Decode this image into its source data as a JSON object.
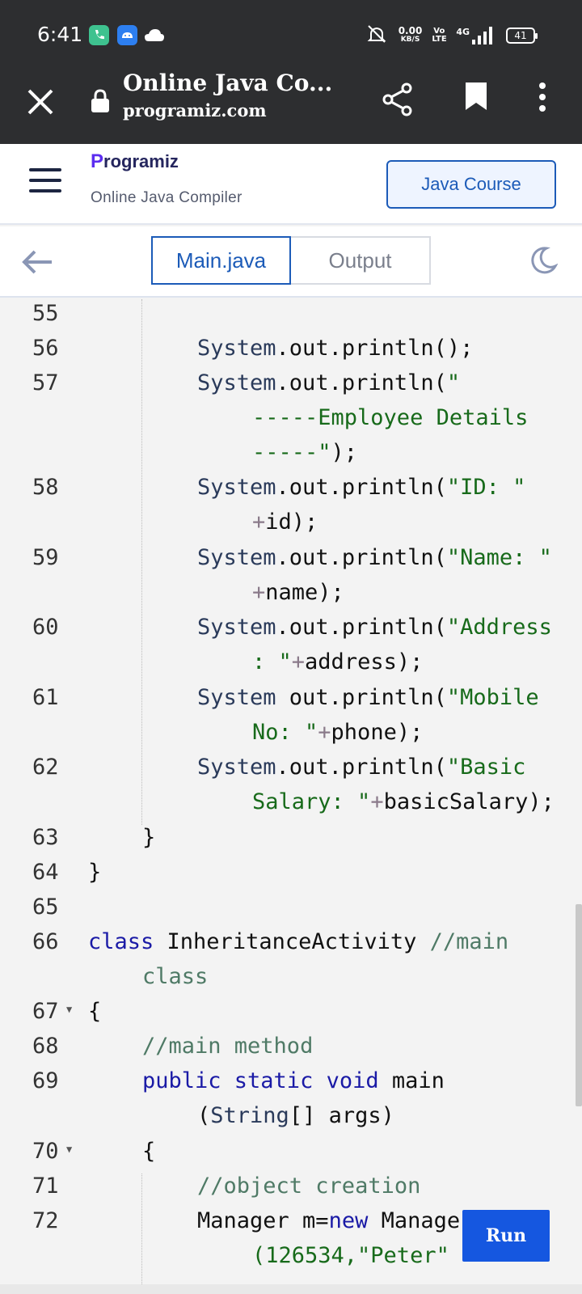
{
  "status_bar": {
    "time": "6:41",
    "speed_value": "0.00",
    "speed_unit": "KB/S",
    "volte": "Vo LTE",
    "network": "4G",
    "battery": "41"
  },
  "browser": {
    "title": "Online Java Co...",
    "url": "programiz.com"
  },
  "site": {
    "logo_letter": "P",
    "logo_rest": "rogramiz",
    "subtitle": "Online Java Compiler",
    "course_button": "Java Course"
  },
  "editor": {
    "tabs": [
      {
        "label": "Main.java",
        "active": true
      },
      {
        "label": "Output",
        "active": false
      }
    ],
    "run_label": "Run",
    "lines": [
      {
        "num": "55"
      },
      {
        "num": "56"
      },
      {
        "num": "57"
      },
      {
        "num": "58"
      },
      {
        "num": "59"
      },
      {
        "num": "60"
      },
      {
        "num": "61"
      },
      {
        "num": "62"
      },
      {
        "num": "63"
      },
      {
        "num": "64"
      },
      {
        "num": "65"
      },
      {
        "num": "66"
      },
      {
        "num": "67"
      },
      {
        "num": "68"
      },
      {
        "num": "69"
      },
      {
        "num": "70"
      },
      {
        "num": "71"
      },
      {
        "num": "72"
      }
    ]
  },
  "colors": {
    "accent": "#1c5bb8",
    "run_button": "#1557e0",
    "string": "#176a1a",
    "keyword": "#1a1aa6",
    "comment": "#4f7a66",
    "topbar": "#2d2e30"
  }
}
